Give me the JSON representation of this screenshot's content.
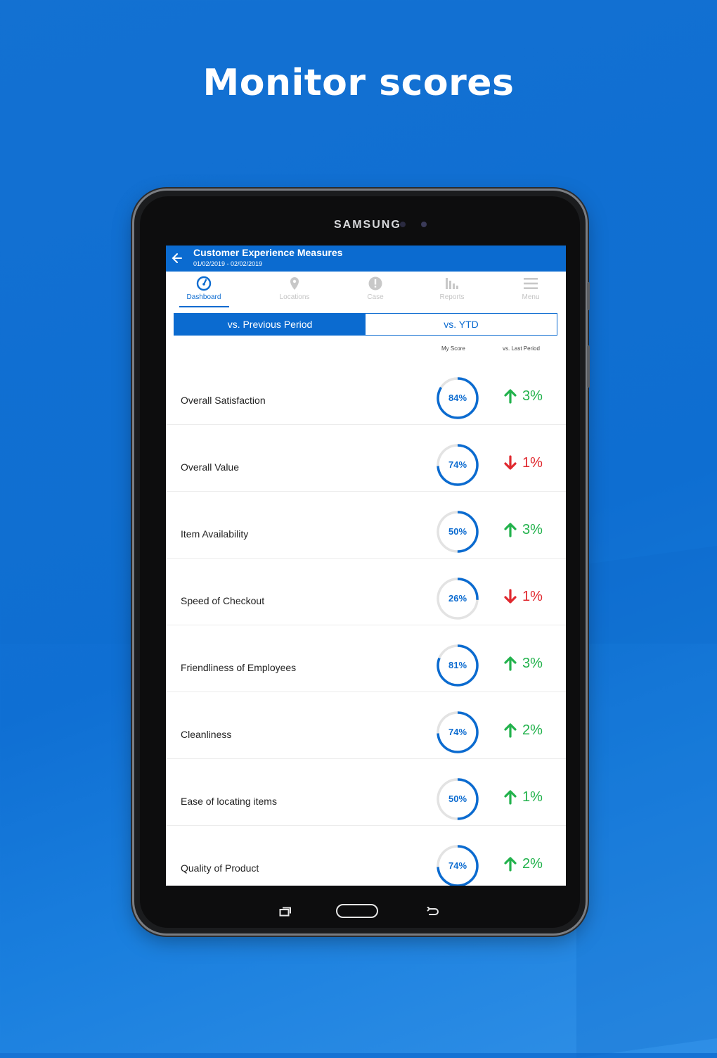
{
  "headline": "Monitor scores",
  "device": {
    "brand": "SAMSUNG"
  },
  "app": {
    "title": "Customer Experience Measures",
    "dates": "01/02/2019 - 02/02/2019"
  },
  "nav": {
    "items": [
      {
        "label": "Dashboard",
        "icon": "dashboard-gauge-icon",
        "active": true
      },
      {
        "label": "Locations",
        "icon": "location-pin-icon",
        "active": false
      },
      {
        "label": "Case",
        "icon": "alert-icon",
        "active": false
      },
      {
        "label": "Reports",
        "icon": "bar-chart-icon",
        "active": false
      },
      {
        "label": "Menu",
        "icon": "hamburger-icon",
        "active": false
      }
    ]
  },
  "segment": {
    "left": "vs. Previous Period",
    "right": "vs. YTD",
    "selected": "left"
  },
  "columns": {
    "score": "My Score",
    "change": "vs. Last Period"
  },
  "colors": {
    "accent": "#0b6bd0",
    "up": "#22b24c",
    "down": "#e0282e"
  },
  "measures": [
    {
      "label": "Overall Satisfaction",
      "score": 84,
      "score_text": "84%",
      "change_text": "3%",
      "direction": "up"
    },
    {
      "label": "Overall Value",
      "score": 74,
      "score_text": "74%",
      "change_text": "1%",
      "direction": "down"
    },
    {
      "label": "Item Availability",
      "score": 50,
      "score_text": "50%",
      "change_text": "3%",
      "direction": "up"
    },
    {
      "label": "Speed of Checkout",
      "score": 26,
      "score_text": "26%",
      "change_text": "1%",
      "direction": "down"
    },
    {
      "label": "Friendliness of Employees",
      "score": 81,
      "score_text": "81%",
      "change_text": "3%",
      "direction": "up"
    },
    {
      "label": "Cleanliness",
      "score": 74,
      "score_text": "74%",
      "change_text": "2%",
      "direction": "up"
    },
    {
      "label": "Ease of locating items",
      "score": 50,
      "score_text": "50%",
      "change_text": "1%",
      "direction": "up"
    },
    {
      "label": "Quality of Product",
      "score": 74,
      "score_text": "74%",
      "change_text": "2%",
      "direction": "up"
    }
  ]
}
